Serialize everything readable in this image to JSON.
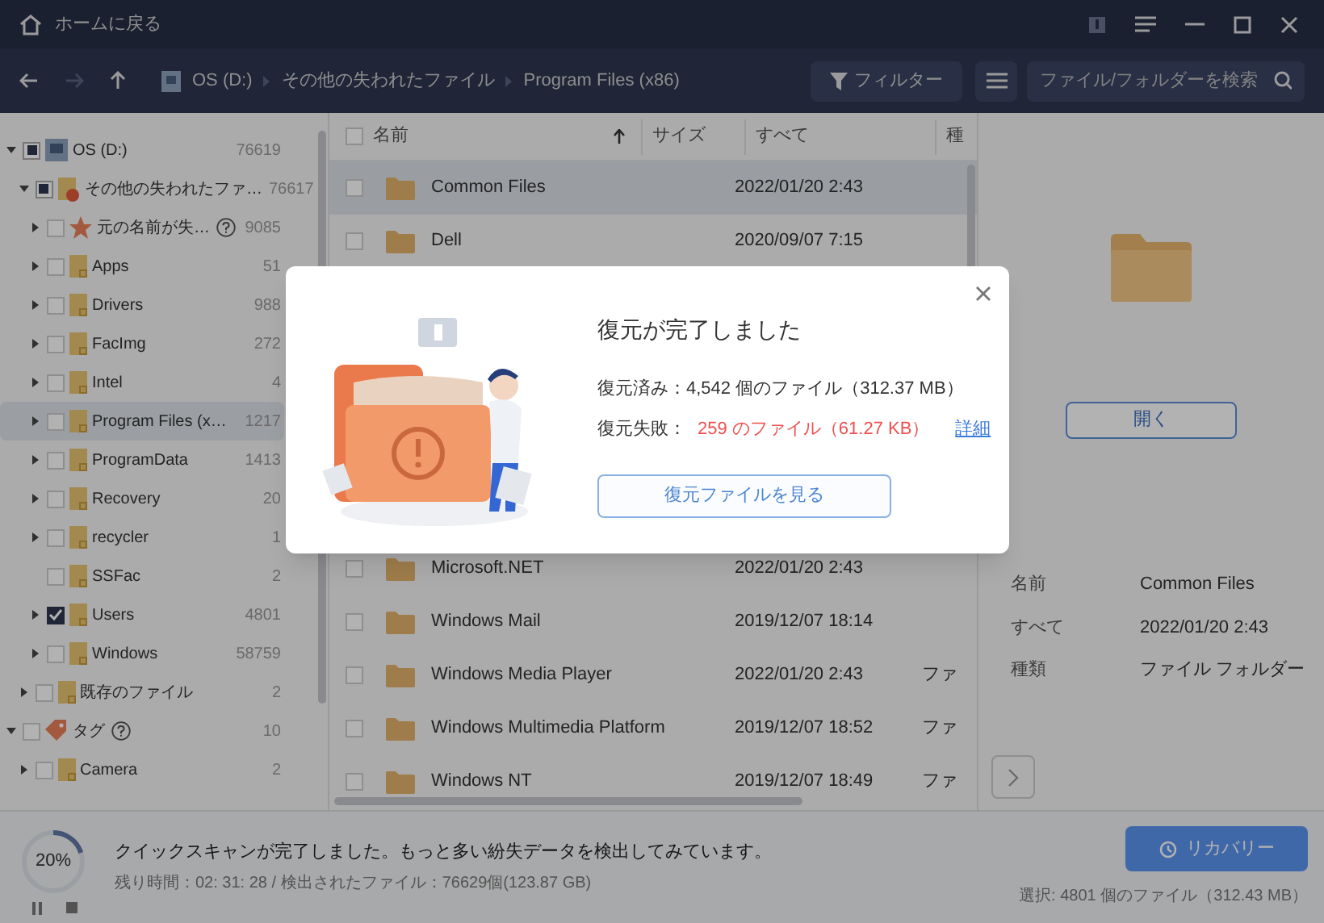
{
  "title_bar": {
    "home_label": "ホームに戻る"
  },
  "breadcrumb": [
    "OS (D:)",
    "その他の失われたファイル",
    "Program Files (x86)"
  ],
  "toolbar": {
    "filter_label": "フィルター",
    "search": {
      "placeholder": "ファイル/フォルダーを検索"
    }
  },
  "tree": [
    {
      "label": "OS (D:)",
      "count": "76619",
      "kind": "drive",
      "checked": false,
      "partial": true,
      "expandable": true,
      "expanded": true,
      "selected": false,
      "help": false,
      "children": [
        {
          "label": "その他の失われたファ…",
          "count": "76617",
          "kind": "lost",
          "checked": false,
          "partial": true,
          "expandable": true,
          "expanded": true,
          "selected": false,
          "help": false,
          "children": [
            {
              "label": "元の名前が失…",
              "count": "9085",
              "kind": "star",
              "checked": false,
              "partial": false,
              "expandable": true,
              "expanded": false,
              "selected": false,
              "help": true
            },
            {
              "label": "Apps",
              "count": "51",
              "kind": "folder",
              "checked": false,
              "partial": false,
              "expandable": true,
              "expanded": false,
              "selected": false,
              "help": false
            },
            {
              "label": "Drivers",
              "count": "988",
              "kind": "folder",
              "checked": false,
              "partial": false,
              "expandable": true,
              "expanded": false,
              "selected": false,
              "help": false
            },
            {
              "label": "FacImg",
              "count": "272",
              "kind": "folder",
              "checked": false,
              "partial": false,
              "expandable": true,
              "expanded": false,
              "selected": false,
              "help": false
            },
            {
              "label": "Intel",
              "count": "4",
              "kind": "folder",
              "checked": false,
              "partial": false,
              "expandable": true,
              "expanded": false,
              "selected": false,
              "help": false
            },
            {
              "label": "Program Files (x…",
              "count": "1217",
              "kind": "folder",
              "checked": false,
              "partial": false,
              "expandable": true,
              "expanded": false,
              "selected": true,
              "help": false
            },
            {
              "label": "ProgramData",
              "count": "1413",
              "kind": "folder",
              "checked": false,
              "partial": false,
              "expandable": true,
              "expanded": false,
              "selected": false,
              "help": false
            },
            {
              "label": "Recovery",
              "count": "20",
              "kind": "folder",
              "checked": false,
              "partial": false,
              "expandable": true,
              "expanded": false,
              "selected": false,
              "help": false
            },
            {
              "label": "recycler",
              "count": "1",
              "kind": "folder",
              "checked": false,
              "partial": false,
              "expandable": true,
              "expanded": false,
              "selected": false,
              "help": false
            },
            {
              "label": "SSFac",
              "count": "2",
              "kind": "folder",
              "checked": false,
              "partial": false,
              "expandable": false,
              "selected": false,
              "help": false
            },
            {
              "label": "Users",
              "count": "4801",
              "kind": "folder",
              "checked": true,
              "partial": false,
              "expandable": true,
              "expanded": false,
              "selected": false,
              "help": false
            },
            {
              "label": "Windows",
              "count": "58759",
              "kind": "folder",
              "checked": false,
              "partial": false,
              "expandable": true,
              "expanded": false,
              "selected": false,
              "help": false
            }
          ]
        },
        {
          "label": "既存のファイル",
          "count": "2",
          "kind": "folder",
          "checked": false,
          "partial": false,
          "expandable": true,
          "expanded": false,
          "selected": false,
          "help": false
        }
      ]
    },
    {
      "label": "タグ",
      "count": "10",
      "kind": "tag",
      "checked": false,
      "partial": false,
      "expandable": true,
      "expanded": true,
      "selected": false,
      "help": true,
      "children": [
        {
          "label": "Camera",
          "count": "2",
          "kind": "folder",
          "checked": false,
          "partial": false,
          "expandable": true,
          "expanded": false,
          "selected": false,
          "help": false
        }
      ]
    }
  ],
  "table": {
    "select_all": {
      "checked": false
    },
    "columns": [
      {
        "label": "名前",
        "sorted": true
      },
      {
        "label": "サイズ",
        "sorted": false
      },
      {
        "label": "すべて",
        "sorted": false
      },
      {
        "label": "種",
        "sorted": false
      }
    ],
    "rows": [
      {
        "name": "Common Files",
        "date": "2022/01/20 2:43",
        "checked": false,
        "selected": true
      },
      {
        "name": "Dell",
        "date": "2020/09/07 7:15",
        "checked": false,
        "selected": false
      },
      {
        "name": "Microsoft.NET",
        "date": "2022/01/20 2:43",
        "checked": false,
        "selected": false
      },
      {
        "name": "Windows Mail",
        "date": "2019/12/07 18:14",
        "checked": false,
        "selected": false
      },
      {
        "name": "Windows Media Player",
        "date": "2022/01/20 2:43",
        "type": "ファ",
        "checked": false,
        "selected": false
      },
      {
        "name": "Windows Multimedia Platform",
        "date": "2019/12/07 18:52",
        "type": "ファ",
        "checked": false,
        "selected": false
      },
      {
        "name": "Windows NT",
        "date": "2019/12/07 18:49",
        "type": "ファ",
        "checked": false,
        "selected": false
      }
    ]
  },
  "preview": {
    "open_label": "開く",
    "details": [
      {
        "key": "名前",
        "value": "Common Files"
      },
      {
        "key": "すべて",
        "value": "2022/01/20 2:43"
      },
      {
        "key": "種類",
        "value": "ファイル フォルダー"
      }
    ]
  },
  "status_bar": {
    "progress": {
      "level": 0.2,
      "reading": "20%"
    },
    "message": "クイックスキャンが完了しました。もっと多い紛失データを検出してみています。",
    "detail": "残り時間：02: 31: 28 / 検出されたファイル：76629個(123.87 GB)",
    "recover_label": "リカバリー",
    "selection": "選択: 4801 個のファイル（312.43 MB）"
  },
  "dialog": {
    "title": "復元が完了しました",
    "recovered_label": "復元済み：",
    "recovered_value": "4,542 個のファイル（312.37 MB）",
    "failed_label": "復元失敗：",
    "failed_value": "259 のファイル（61.27 KB）",
    "details_link": "詳細",
    "view_button": "復元ファイルを見る"
  }
}
